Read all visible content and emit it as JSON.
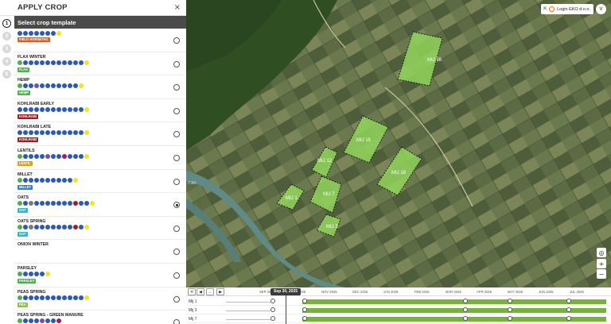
{
  "panel": {
    "title": "APPLY CROP",
    "close_label": "×",
    "steps": [
      "1",
      "2",
      "3",
      "4",
      "5"
    ],
    "template_label": "Select crop template"
  },
  "crops": [
    {
      "name": "",
      "tag": "FIELD HORSETAIL",
      "tag_color": "#e05a1f",
      "dots": [
        "#2e59b3",
        "#2e59b3",
        "#2e59b3",
        "#2e59b3",
        "#2e59b3",
        "#2e59b3",
        "#2e59b3",
        "#f2e22a"
      ],
      "checked": false
    },
    {
      "name": "FLAX WINTER",
      "tag": "FLAX",
      "tag_color": "#4caf50",
      "dots": [
        "#4caf50",
        "#2e59b3",
        "#2e59b3",
        "#2e59b3",
        "#2e59b3",
        "#2e59b3",
        "#2e59b3",
        "#2e59b3",
        "#2e59b3",
        "#2e59b3",
        "#2e59b3",
        "#2e59b3",
        "#f2e22a"
      ],
      "checked": false
    },
    {
      "name": "HEMP",
      "tag": "HEMP",
      "tag_color": "#4caf50",
      "dots": [
        "#4caf50",
        "#2e59b3",
        "#2e59b3",
        "#7a4fa0",
        "#2e59b3",
        "#2e59b3",
        "#2e59b3",
        "#2e59b3",
        "#2e59b3",
        "#2e59b3",
        "#2e59b3",
        "#f2e22a"
      ],
      "checked": false
    },
    {
      "name": "KOHLRABI EARLY",
      "tag": "KOHLRABI",
      "tag_color": "#a11d1d",
      "dots": [
        "#2e59b3",
        "#2e59b3",
        "#2e59b3",
        "#2e59b3",
        "#2e59b3",
        "#2e59b3",
        "#2e59b3",
        "#2e59b3",
        "#2e59b3",
        "#2e59b3",
        "#2e59b3",
        "#2e59b3",
        "#f2e22a"
      ],
      "checked": false
    },
    {
      "name": "KOHLRABI LATE",
      "tag": "KOHLRABI",
      "tag_color": "#a11d1d",
      "dots": [
        "#2e59b3",
        "#2e59b3",
        "#2e59b3",
        "#2e59b3",
        "#2e59b3",
        "#2e59b3",
        "#2e59b3",
        "#2e59b3",
        "#2e59b3",
        "#2e59b3",
        "#2e59b3",
        "#2e59b3",
        "#f2e22a"
      ],
      "checked": false
    },
    {
      "name": "LENTILS",
      "tag": "LENTIL",
      "tag_color": "#d6a21a",
      "dots": [
        "#4caf50",
        "#2e59b3",
        "#2e59b3",
        "#2e59b3",
        "#2e59b3",
        "#7a4fa0",
        "#2e59b3",
        "#2e59b3",
        "#a11d57",
        "#2e59b3",
        "#2e59b3",
        "#2e59b3",
        "#f2e22a"
      ],
      "checked": false
    },
    {
      "name": "MILLET",
      "tag": "MILLET",
      "tag_color": "#3a7dc9",
      "dots": [
        "#4caf50",
        "#2e59b3",
        "#2e59b3",
        "#2e59b3",
        "#2e59b3",
        "#2e59b3",
        "#2e59b3",
        "#2e59b3",
        "#2e59b3",
        "#2e59b3",
        "#f2e22a"
      ],
      "checked": false
    },
    {
      "name": "OATS",
      "tag": "OAT",
      "tag_color": "#3ab0c4",
      "dots": [
        "#4caf50",
        "#2e59b3",
        "#7a7a7a",
        "#2e59b3",
        "#2e59b3",
        "#2e59b3",
        "#2e59b3",
        "#2e59b3",
        "#2e59b3",
        "#2e59b3",
        "#a11d1d",
        "#2e59b3",
        "#2e59b3",
        "#f2e22a"
      ],
      "checked": true
    },
    {
      "name": "OATS SPRING",
      "tag": "OAT",
      "tag_color": "#3ab0c4",
      "dots": [
        "#4caf50",
        "#2e59b3",
        "#7a7a7a",
        "#2e59b3",
        "#2e59b3",
        "#2e59b3",
        "#2e59b3",
        "#2e59b3",
        "#2e59b3",
        "#2e59b3",
        "#a11d1d",
        "#2e59b3",
        "#f2e22a"
      ],
      "checked": false
    },
    {
      "name": "ONION WINTER",
      "tag": "",
      "tag_color": "#4caf50",
      "dots": [],
      "checked": false
    },
    {
      "name": "PARSLEY",
      "tag": "PARSLEY",
      "tag_color": "#4caf50",
      "dots": [
        "#4caf50",
        "#2e59b3",
        "#2e59b3",
        "#2e59b3",
        "#2e59b3",
        "#f2e22a"
      ],
      "checked": false
    },
    {
      "name": "PEAS SPRING",
      "tag": "PEA",
      "tag_color": "#8bc34a",
      "dots": [
        "#4caf50",
        "#2e59b3",
        "#2e59b3",
        "#2e59b3",
        "#2e59b3",
        "#2e59b3",
        "#2e59b3",
        "#2e59b3",
        "#2e59b3",
        "#2e59b3",
        "#2e59b3",
        "#2e59b3",
        "#f2e22a"
      ],
      "checked": false
    },
    {
      "name": "PEAS SPRING - GREEN MANURE",
      "tag": "PEA",
      "tag_color": "#8bc34a",
      "dots": [
        "#4caf50",
        "#2e59b3",
        "#2e59b3",
        "#2e59b3",
        "#7a4fa0",
        "#2e59b3",
        "#2e59b3",
        "#a11d57"
      ],
      "checked": false
    }
  ],
  "map": {
    "company": "Login EKO d.o.o.",
    "user_initial": "V",
    "map_label_bottom": "ITAK",
    "fields": [
      {
        "label": "MIJ 16"
      },
      {
        "label": "MIJ 15"
      },
      {
        "label": "MIJ 12"
      },
      {
        "label": "MIJ 18"
      },
      {
        "label": "MIJ 1"
      },
      {
        "label": "MIJ 7"
      },
      {
        "label": "MIJ 3"
      }
    ],
    "zoom_in": "+",
    "zoom_out": "−"
  },
  "timeline": {
    "current_date": "Sep 30, 2025",
    "months": [
      "SEP 2025",
      "OCT 2025",
      "NOV 2025",
      "DEC 2025",
      "JAN 2026",
      "FEB 2026",
      "MAR 2026",
      "APR 2026",
      "MAY 2026",
      "JUN 2026",
      "JUL 2026"
    ],
    "rows": [
      {
        "label": "Mij 1"
      },
      {
        "label": "Mij 3"
      },
      {
        "label": "Mij 7"
      }
    ]
  },
  "colors": {
    "field_fill": "#8fd35a",
    "accent_green": "#77b33b"
  }
}
